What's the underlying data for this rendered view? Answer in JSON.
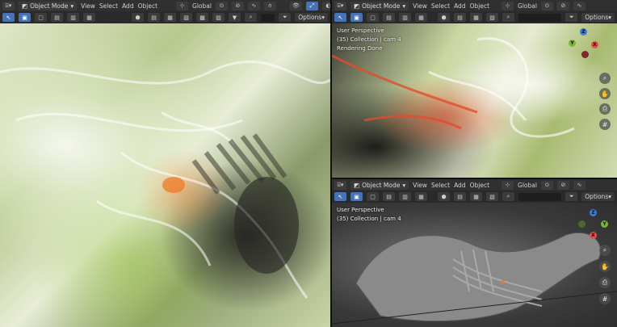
{
  "header": {
    "editor_icon": "editor-type-icon",
    "mode_label": "Object Mode",
    "menus": [
      "View",
      "Select",
      "Add",
      "Object"
    ],
    "orientation_label": "Global",
    "options_label": "Options"
  },
  "viewports": {
    "left": {
      "perspective": "",
      "collection": "",
      "status": ""
    },
    "top_right": {
      "perspective": "User Perspective",
      "collection": "(35) Collection | cam 4",
      "status": "Rendering Done"
    },
    "bottom_right": {
      "perspective": "User Perspective",
      "collection": "(35) Collection | cam 4",
      "status": ""
    }
  },
  "gizmo_axes": {
    "x": "X",
    "y": "Y",
    "z": "Z"
  },
  "colors": {
    "accent": "#4772b3",
    "x_axis": "#e34d4d",
    "y_axis": "#7ab82e",
    "z_axis": "#3a7be0"
  },
  "icons": {
    "zoom": "zoom-icon",
    "pan": "hand-icon",
    "camera": "camera-icon",
    "grid": "grid-icon"
  }
}
